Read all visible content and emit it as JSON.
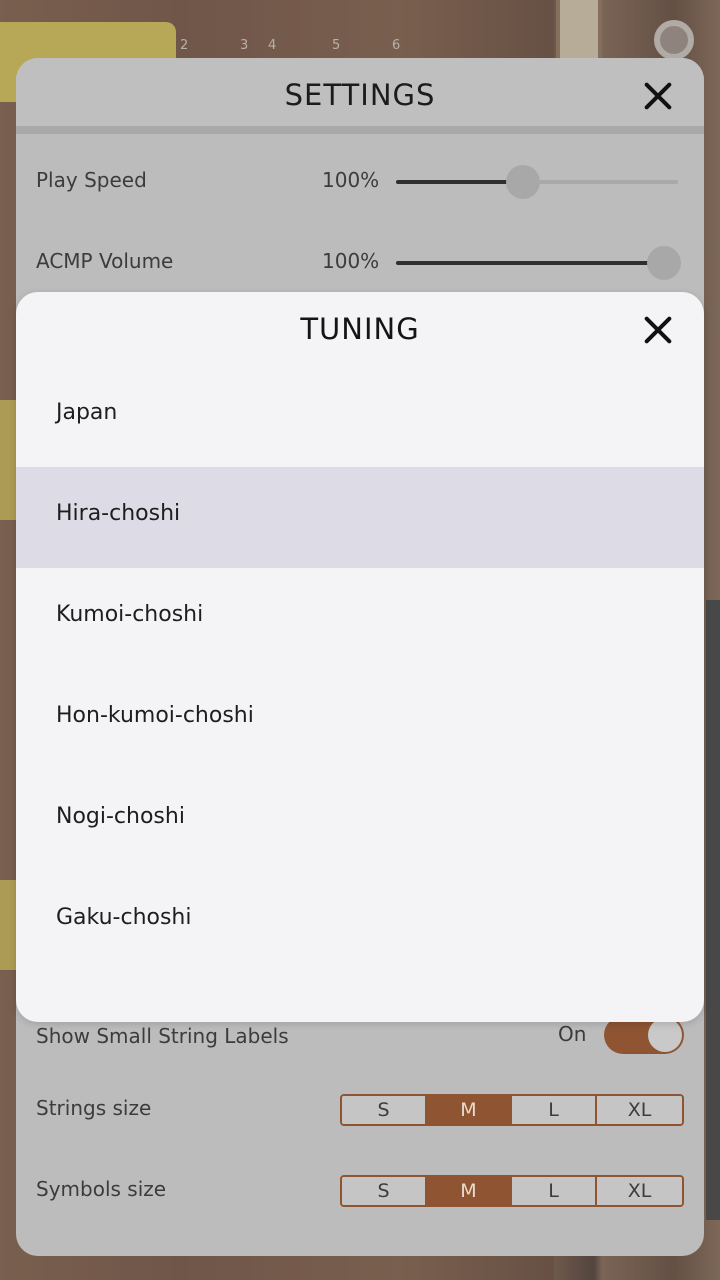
{
  "background": {
    "fret_numbers": [
      "2",
      "3",
      "4",
      "5",
      "6"
    ]
  },
  "settings": {
    "title": "SETTINGS",
    "rows": {
      "play_speed": {
        "label": "Play Speed",
        "value": "100%",
        "level": 0.45
      },
      "acmp_volume": {
        "label": "ACMP Volume",
        "value": "100%",
        "level": 0.95
      },
      "small_string_labels": {
        "label": "Show Small String Labels",
        "state": "On"
      },
      "strings_size": {
        "label": "Strings size",
        "options": [
          "S",
          "M",
          "L",
          "XL"
        ],
        "selected": "M"
      },
      "symbols_size": {
        "label": "Symbols size",
        "options": [
          "S",
          "M",
          "L",
          "XL"
        ],
        "selected": "M"
      }
    }
  },
  "tuning": {
    "title": "TUNING",
    "items": [
      "Japan",
      "Hira-choshi",
      "Kumoi-choshi",
      "Hon-kumoi-choshi",
      "Nogi-choshi",
      "Gaku-choshi"
    ],
    "selected": "Hira-choshi"
  },
  "colors": {
    "accent": "#8f5533",
    "selected_row": "#dcdbe6",
    "modal_bg": "#f4f4f7"
  }
}
